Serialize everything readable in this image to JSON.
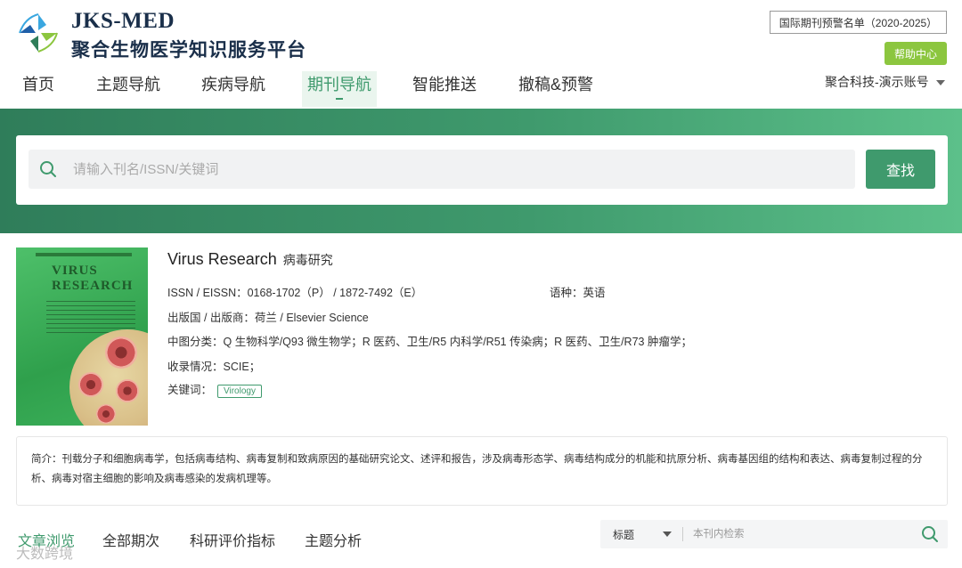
{
  "brand": {
    "name_en": "JKS-MED",
    "name_cn": "聚合生物医学知识服务平台"
  },
  "header": {
    "warning_list": "国际期刊预警名单（2020-2025）",
    "help": "帮助中心",
    "account": "聚合科技-演示账号"
  },
  "nav": {
    "items": [
      {
        "label": "首页"
      },
      {
        "label": "主题导航"
      },
      {
        "label": "疾病导航"
      },
      {
        "label": "期刊导航"
      },
      {
        "label": "智能推送"
      },
      {
        "label": "撤稿&预警"
      }
    ],
    "active": "期刊导航"
  },
  "search": {
    "placeholder": "请输入刊名/ISSN/关键词",
    "button": "查找"
  },
  "journal": {
    "cover_title": "VIRUS RESEARCH",
    "title_en": "Virus Research",
    "title_cn": "病毒研究",
    "issn_label": "ISSN / EISSN：",
    "issn_value": "0168-1702（P） / 1872-7492（E）",
    "language_label": "语种：",
    "language_value": "英语",
    "publisher_label": "出版国 / 出版商：",
    "publisher_value": "荷兰 / Elsevier Science",
    "clc_label": "中图分类：",
    "clc_value": "Q 生物科学/Q93 微生物学；R 医药、卫生/R5 内科学/R51 传染病；R 医药、卫生/R73 肿瘤学；",
    "indexed_label": "收录情况：",
    "indexed_value": "SCIE；",
    "keywords_label": "关键词：",
    "keywords": [
      "Virology"
    ],
    "intro": "简介：刊载分子和细胞病毒学，包括病毒结构、病毒复制和致病原因的基础研究论文、述评和报告，涉及病毒形态学、病毒结构成分的机能和抗原分析、病毒基因组的结构和表达、病毒复制过程的分析、病毒对宿主细胞的影响及病毒感染的发病机理等。"
  },
  "tabs": {
    "items": [
      {
        "label": "文章浏览"
      },
      {
        "label": "全部期次"
      },
      {
        "label": "科研评价指标"
      },
      {
        "label": "主题分析"
      }
    ],
    "active": "文章浏览"
  },
  "inner_search": {
    "field": "标题",
    "placeholder": "本刊内检索"
  },
  "watermark": "大数跨境",
  "colors": {
    "accent": "#3f9a6d",
    "help_button": "#8cc63f",
    "brand_text": "#1a2f4a"
  }
}
